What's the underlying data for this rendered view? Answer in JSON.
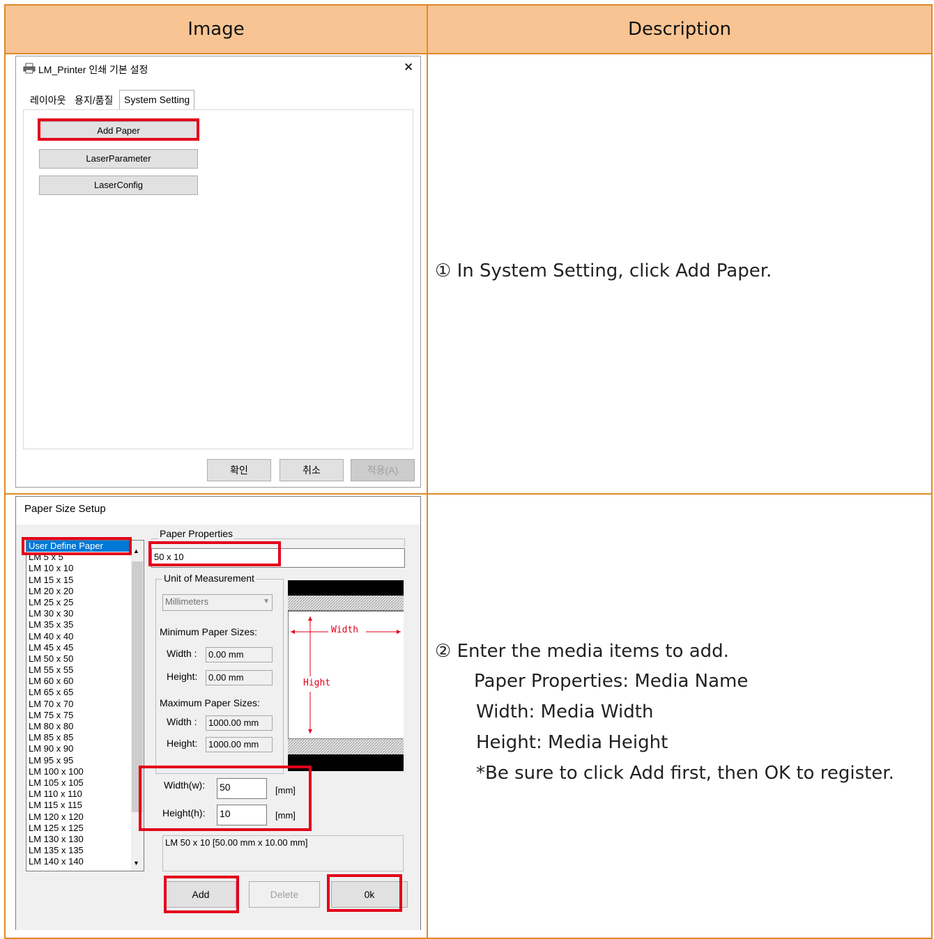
{
  "table": {
    "header_image": "Image",
    "header_description": "Description"
  },
  "rows": [
    {
      "description_lines": [
        "① In System Setting, click Add Paper."
      ]
    },
    {
      "description_lines": [
        "② Enter the media items to add.",
        "Paper Properties: Media Name",
        "Width: Media Width",
        "Height: Media Height",
        "*Be sure to click Add first, then OK to register."
      ]
    }
  ],
  "dialog1": {
    "title": "LM_Printer 인쇄 기본 설정",
    "printer_icon": "printer-icon",
    "close_label": "✕",
    "tabs": [
      "레이아웃",
      "용지/품질",
      "System Setting"
    ],
    "active_tab": "System Setting",
    "buttons": [
      "Add Paper",
      "LaserParameter",
      "LaserConfig"
    ],
    "footer_buttons": {
      "ok": "확인",
      "cancel": "취소",
      "apply": "적용(A)"
    },
    "highlight_color": "#e3001b"
  },
  "dialog2": {
    "title": "Paper Size Setup",
    "paper_list": [
      "User Define Paper",
      "LM 5 x 5",
      "LM 10 x 10",
      "LM 15 x 15",
      "LM 20 x 20",
      "LM 25 x 25",
      "LM 30 x 30",
      "LM 35 x 35",
      "LM 40 x 40",
      "LM 45 x 45",
      "LM 50 x 50",
      "LM 55 x 55",
      "LM 60 x 60",
      "LM 65 x 65",
      "LM 70 x 70",
      "LM 75 x 75",
      "LM 80 x 80",
      "LM 85 x 85",
      "LM 90 x 90",
      "LM 95 x 95",
      "LM 100 x 100",
      "LM 105 x 105",
      "LM 110 x 110",
      "LM 115 x 115",
      "LM 120 x 120",
      "LM 125 x 125",
      "LM 130 x 130",
      "LM 135 x 135",
      "LM 140 x 140"
    ],
    "selected_paper": "User Define Paper",
    "paper_properties_title": "Paper Properties",
    "paper_name_value": "50 x 10",
    "unit_title": "Unit of Measurement",
    "unit_value": "Millimeters",
    "min_title": "Minimum Paper Sizes:",
    "max_title": "Maximum Paper Sizes:",
    "width_label": "Width :",
    "height_label": "Height:",
    "min_width": "0.00 mm",
    "min_height": "0.00 mm",
    "max_width": "1000.00 mm",
    "max_height": "1000.00 mm",
    "diagram_width_label": "Width",
    "diagram_height_label": "Hight",
    "width_w_label": "Width(w):",
    "height_h_label": "Height(h):",
    "width_w_value": "50",
    "height_h_value": "10",
    "unit_suffix": "[mm]",
    "summary": "LM 50 x 10 [50.00 mm x 10.00 mm]",
    "buttons": {
      "add": "Add",
      "delete": "Delete",
      "ok": "0k"
    }
  }
}
